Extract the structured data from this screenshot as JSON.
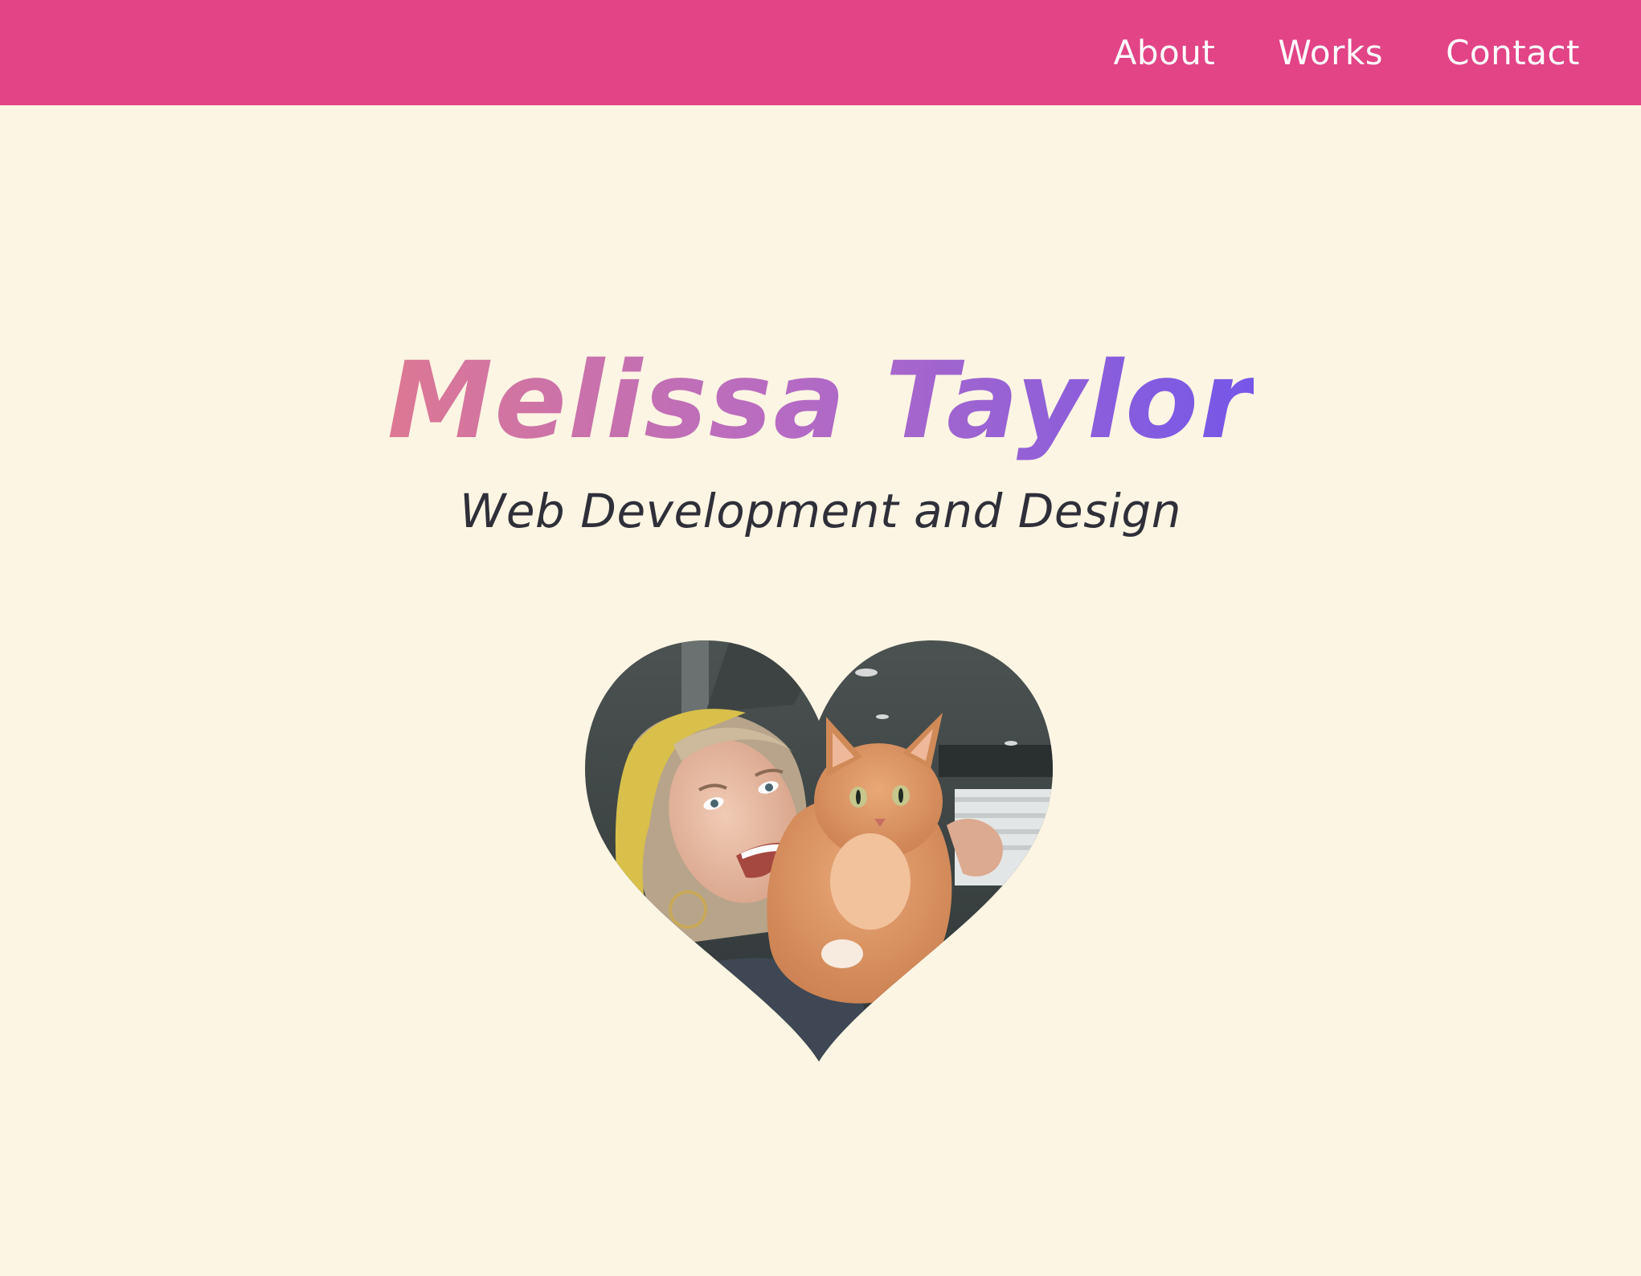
{
  "nav": {
    "items": [
      {
        "label": "About"
      },
      {
        "label": "Works"
      },
      {
        "label": "Contact"
      }
    ]
  },
  "hero": {
    "title": "Melissa Taylor",
    "subtitle": "Web Development and Design",
    "photo_icon": "heart-shaped-photo"
  },
  "colors": {
    "navbar": "#e24486",
    "background": "#fcf5e3",
    "title_gradient_start": "#dd7894",
    "title_gradient_end": "#7557e8",
    "subtitle": "#2f2f3a"
  }
}
